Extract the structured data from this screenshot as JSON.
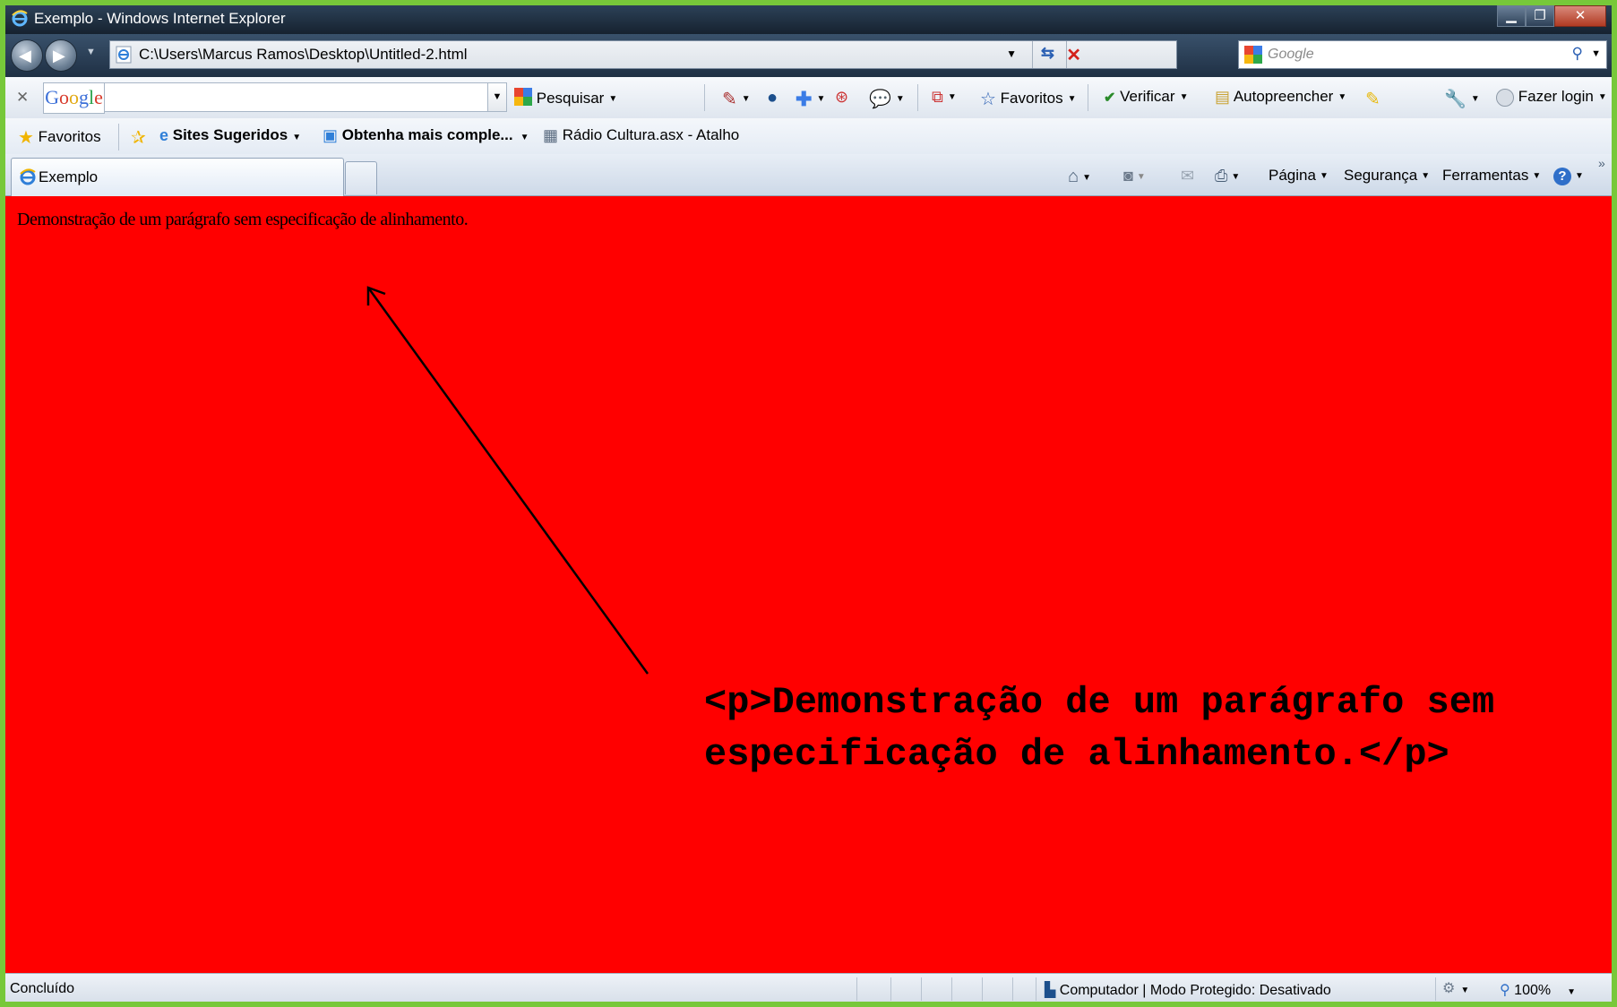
{
  "window": {
    "title": "Exemplo - Windows Internet Explorer",
    "min_glyph": "▁",
    "max_glyph": "❐",
    "close_glyph": "✕"
  },
  "address": {
    "url": "C:\\Users\\Marcus Ramos\\Desktop\\Untitled-2.html",
    "search_placeholder": "Google"
  },
  "google_toolbar": {
    "logo": "Google",
    "search_button": "Pesquisar",
    "favorites": "Favoritos",
    "spellcheck": "Verificar",
    "autofill": "Autopreencher",
    "login": "Fazer login"
  },
  "favorites_bar": {
    "favorites": "Favoritos",
    "suggested_sites": "Sites Sugeridos",
    "get_more": "Obtenha mais comple...",
    "shortcut": "Rádio Cultura.asx - Atalho"
  },
  "tabs": [
    {
      "label": "Exemplo"
    }
  ],
  "command_bar": {
    "page": "Página",
    "safety": "Segurança",
    "tools": "Ferramentas",
    "overflow": "»"
  },
  "content": {
    "paragraph": "Demonstração de um parágrafo sem especificação de alinhamento.",
    "code_annotation": "<p>Demonstração de um parágrafo sem especificação de alinhamento.</p>"
  },
  "status_bar": {
    "status": "Concluído",
    "zone": "Computador | Modo Protegido: Desativado",
    "zoom": "100%"
  },
  "colors": {
    "page_background": "#ff0000",
    "outer_border": "#77c83a"
  }
}
